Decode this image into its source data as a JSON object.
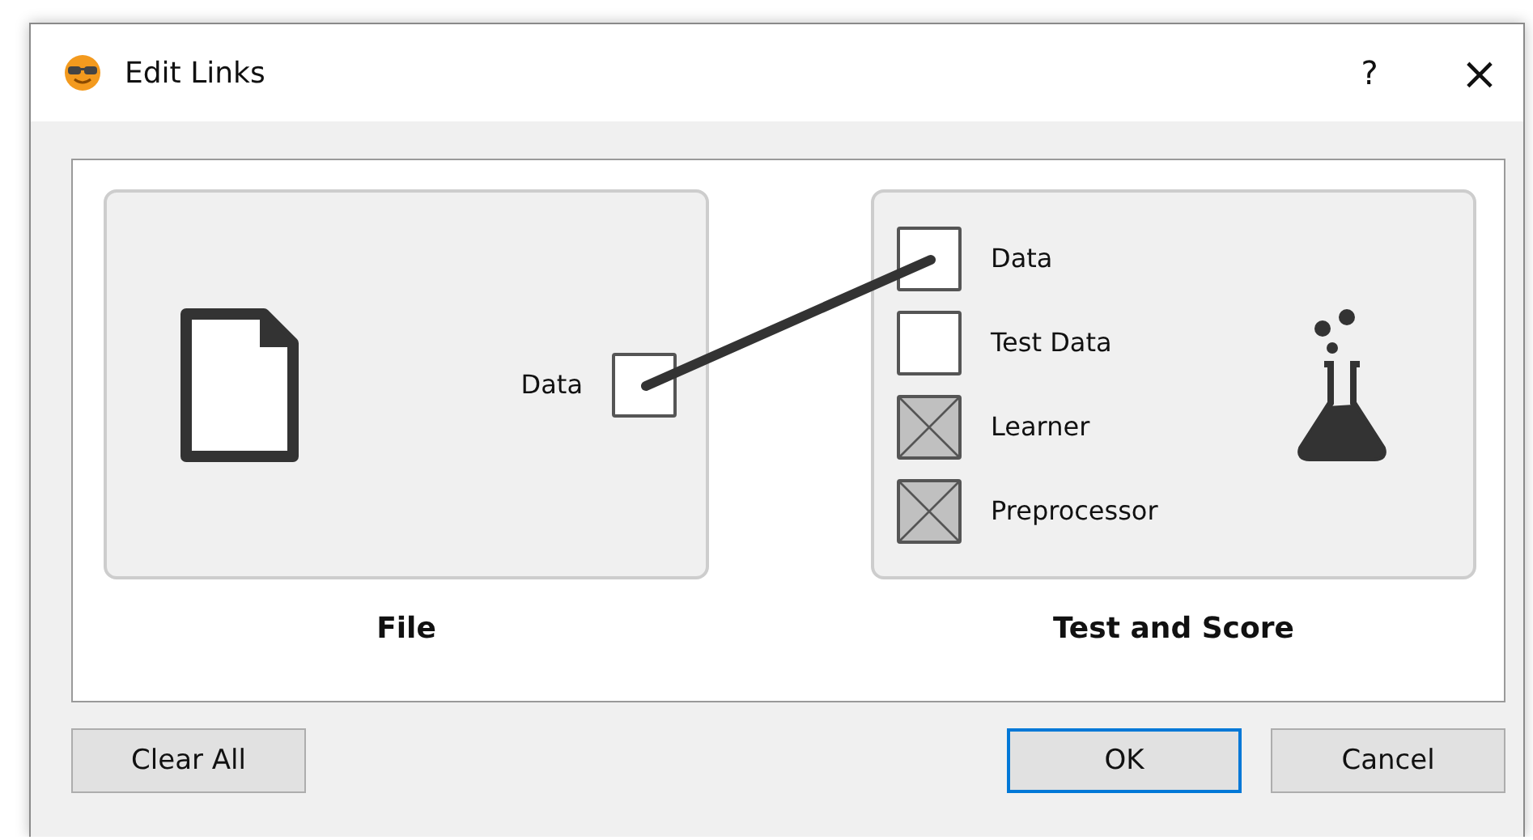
{
  "window": {
    "title": "Edit Links",
    "help": "?",
    "close": "×"
  },
  "source": {
    "title": "File",
    "outputs": [
      {
        "label": "Data"
      }
    ]
  },
  "sink": {
    "title": "Test and Score",
    "inputs": [
      {
        "label": "Data",
        "kind": "open",
        "linked": true
      },
      {
        "label": "Test Data",
        "kind": "open",
        "linked": false
      },
      {
        "label": "Learner",
        "kind": "disabled",
        "linked": false
      },
      {
        "label": "Preprocessor",
        "kind": "disabled",
        "linked": false
      }
    ]
  },
  "buttons": [
    {
      "label": "Clear All",
      "default": false
    },
    {
      "label": "OK",
      "default": true
    },
    {
      "label": "Cancel",
      "default": false
    }
  ]
}
